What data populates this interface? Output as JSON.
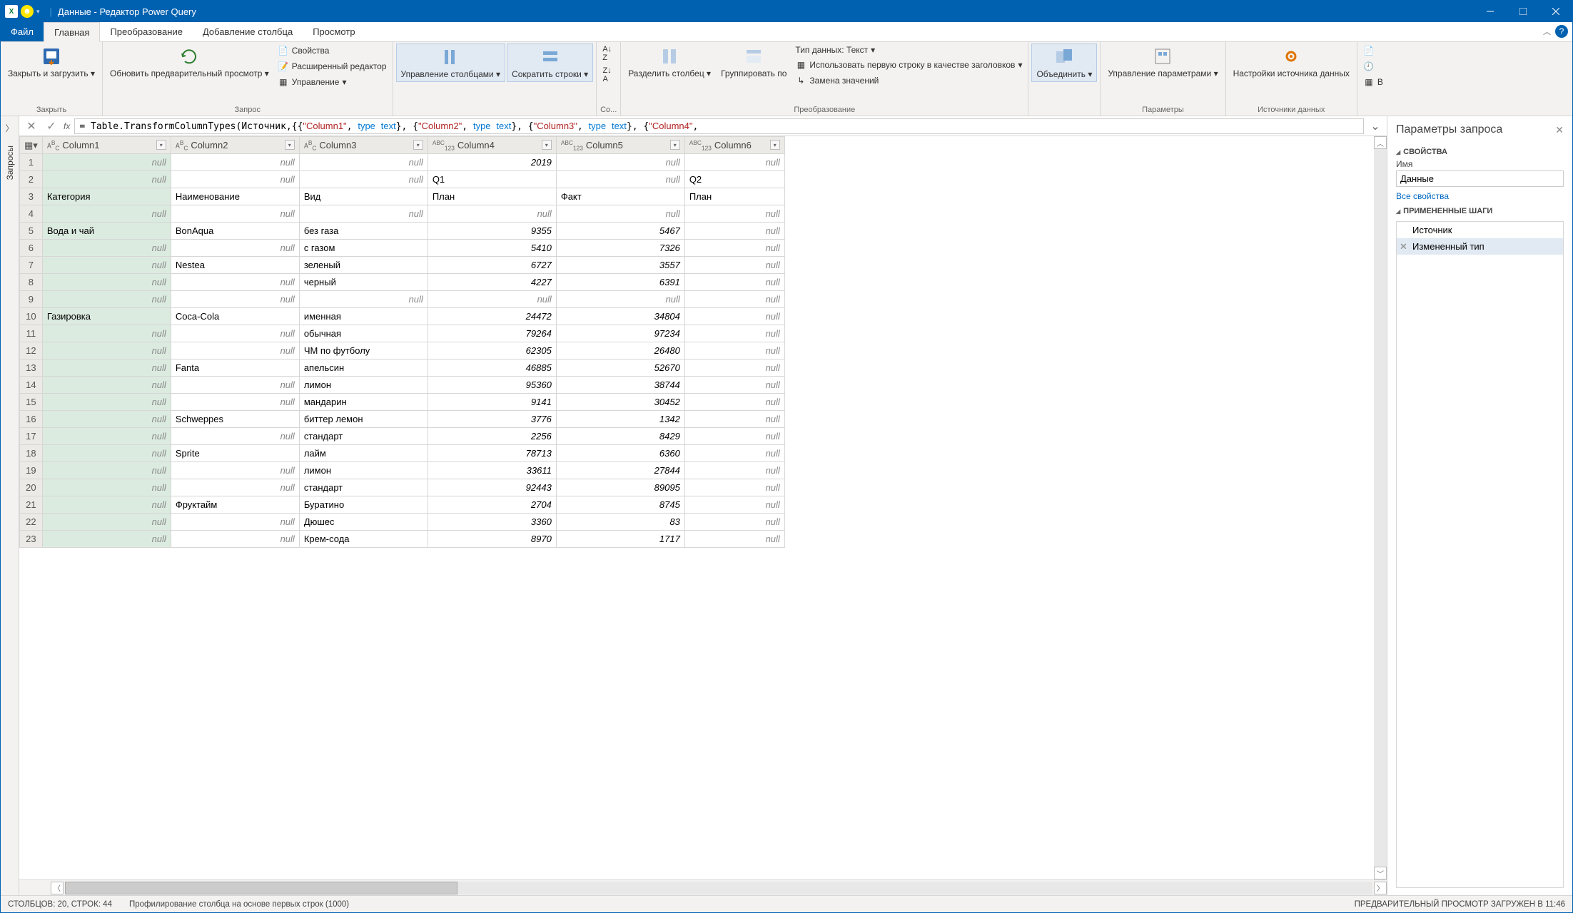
{
  "title": "Данные - Редактор Power Query",
  "tabs": {
    "file": "Файл",
    "home": "Главная",
    "transform": "Преобразование",
    "addcol": "Добавление столбца",
    "view": "Просмотр"
  },
  "ribbon": {
    "close": {
      "label": "Закрыть и загрузить",
      "group": "Закрыть"
    },
    "refresh": {
      "label": "Обновить предварительный просмотр"
    },
    "query": {
      "props": "Свойства",
      "advanced": "Расширенный редактор",
      "manage": "Управление",
      "group": "Запрос"
    },
    "cols": {
      "manage": "Управление столбцами",
      "reduce": "Сократить строки"
    },
    "sort": {
      "group": "Со..."
    },
    "split": "Разделить столбец",
    "groupby": "Группировать по",
    "datatype": "Тип данных: Текст",
    "firstrow": "Использовать первую строку в качестве заголовков",
    "replace": "Замена значений",
    "transform_group": "Преобразование",
    "combine": "Объединить",
    "params": {
      "label": "Управление параметрами",
      "group": "Параметры"
    },
    "source": {
      "label": "Настройки источника данных",
      "group": "Источники данных"
    }
  },
  "formula_plain": "= Table.TransformColumnTypes(Источник,{{\"Column1\", type text}, {\"Column2\", type text}, {\"Column3\", type text}, {\"Column4\",",
  "columns": [
    {
      "name": "Column1",
      "type": "ABC"
    },
    {
      "name": "Column2",
      "type": "ABC"
    },
    {
      "name": "Column3",
      "type": "ABC"
    },
    {
      "name": "Column4",
      "type": "ABC123"
    },
    {
      "name": "Column5",
      "type": "ABC123"
    },
    {
      "name": "Column6",
      "type": "ABC123"
    }
  ],
  "rows": [
    [
      null,
      null,
      null,
      "2019",
      null,
      null
    ],
    [
      null,
      null,
      null,
      "Q1",
      null,
      "Q2"
    ],
    [
      "Категория",
      "Наименование",
      "Вид",
      "План",
      "Факт",
      "План"
    ],
    [
      null,
      null,
      null,
      null,
      null,
      null
    ],
    [
      "Вода и чай",
      "BonAqua",
      "без газа",
      "9355",
      "5467",
      null
    ],
    [
      null,
      null,
      "с газом",
      "5410",
      "7326",
      null
    ],
    [
      null,
      "Nestea",
      "зеленый",
      "6727",
      "3557",
      null
    ],
    [
      null,
      null,
      "черный",
      "4227",
      "6391",
      null
    ],
    [
      null,
      null,
      null,
      null,
      null,
      null
    ],
    [
      "Газировка",
      "Coca-Cola",
      "именная",
      "24472",
      "34804",
      null
    ],
    [
      null,
      null,
      "обычная",
      "79264",
      "97234",
      null
    ],
    [
      null,
      null,
      "ЧМ по футболу",
      "62305",
      "26480",
      null
    ],
    [
      null,
      "Fanta",
      "апельсин",
      "46885",
      "52670",
      null
    ],
    [
      null,
      null,
      "лимон",
      "95360",
      "38744",
      null
    ],
    [
      null,
      null,
      "мандарин",
      "9141",
      "30452",
      null
    ],
    [
      null,
      "Schweppes",
      "биттер лемон",
      "3776",
      "1342",
      null
    ],
    [
      null,
      null,
      "стандарт",
      "2256",
      "8429",
      null
    ],
    [
      null,
      "Sprite",
      "лайм",
      "78713",
      "6360",
      null
    ],
    [
      null,
      null,
      "лимон",
      "33611",
      "27844",
      null
    ],
    [
      null,
      null,
      "стандарт",
      "92443",
      "89095",
      null
    ],
    [
      null,
      "Фруктайм",
      "Буратино",
      "2704",
      "8745",
      null
    ],
    [
      null,
      null,
      "Дюшес",
      "3360",
      "83",
      null
    ],
    [
      null,
      null,
      "Крем-сода",
      "8970",
      "1717",
      null
    ]
  ],
  "settings": {
    "title": "Параметры запроса",
    "props_section": "СВОЙСТВА",
    "name_label": "Имя",
    "name_value": "Данные",
    "all_props": "Все свойства",
    "steps_section": "ПРИМЕНЕННЫЕ ШАГИ",
    "steps": [
      "Источник",
      "Измененный тип"
    ]
  },
  "status": {
    "counts": "СТОЛБЦОВ: 20, СТРОК: 44",
    "profile": "Профилирование столбца на основе первых строк (1000)",
    "preview": "ПРЕДВАРИТЕЛЬНЫЙ ПРОСМОТР ЗАГРУЖЕН В 11:46"
  },
  "queries_label": "Запросы"
}
